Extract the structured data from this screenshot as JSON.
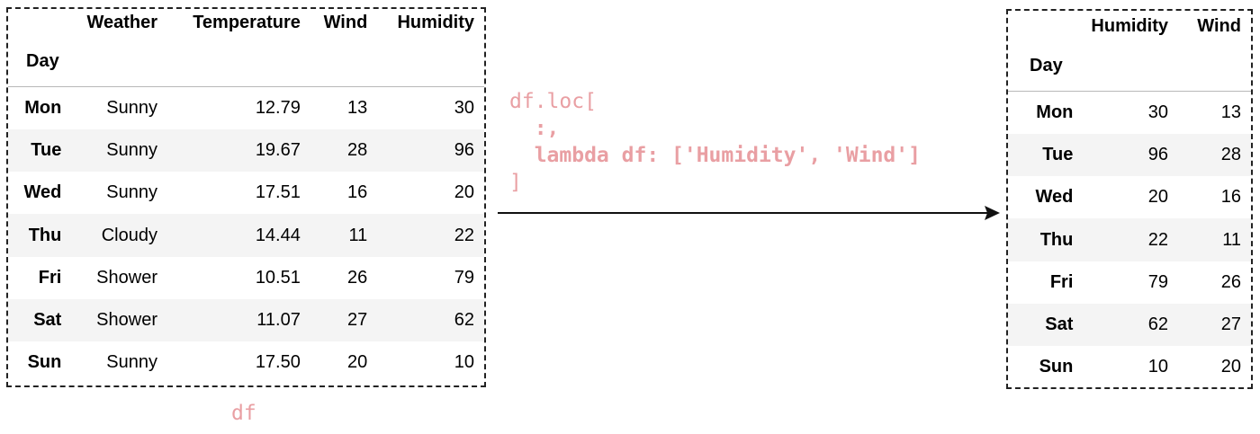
{
  "source_table": {
    "index_name": "Day",
    "columns": [
      "Weather",
      "Temperature",
      "Wind",
      "Humidity"
    ],
    "rows": [
      {
        "day": "Mon",
        "cells": [
          "Sunny",
          "12.79",
          "13",
          "30"
        ]
      },
      {
        "day": "Tue",
        "cells": [
          "Sunny",
          "19.67",
          "28",
          "96"
        ]
      },
      {
        "day": "Wed",
        "cells": [
          "Sunny",
          "17.51",
          "16",
          "20"
        ]
      },
      {
        "day": "Thu",
        "cells": [
          "Cloudy",
          "14.44",
          "11",
          "22"
        ]
      },
      {
        "day": "Fri",
        "cells": [
          "Shower",
          "10.51",
          "26",
          "79"
        ]
      },
      {
        "day": "Sat",
        "cells": [
          "Shower",
          "11.07",
          "27",
          "62"
        ]
      },
      {
        "day": "Sun",
        "cells": [
          "Sunny",
          "17.50",
          "20",
          "10"
        ]
      }
    ],
    "caption": "df"
  },
  "code": {
    "line1": "df.loc[",
    "line2": "  :,",
    "line3": "  lambda df: ['Humidity', 'Wind']",
    "line4": "]"
  },
  "result_table": {
    "index_name": "Day",
    "columns": [
      "Humidity",
      "Wind"
    ],
    "rows": [
      {
        "day": "Mon",
        "cells": [
          "30",
          "13"
        ]
      },
      {
        "day": "Tue",
        "cells": [
          "96",
          "28"
        ]
      },
      {
        "day": "Wed",
        "cells": [
          "20",
          "16"
        ]
      },
      {
        "day": "Thu",
        "cells": [
          "22",
          "11"
        ]
      },
      {
        "day": "Fri",
        "cells": [
          "79",
          "26"
        ]
      },
      {
        "day": "Sat",
        "cells": [
          "62",
          "27"
        ]
      },
      {
        "day": "Sun",
        "cells": [
          "10",
          "20"
        ]
      }
    ]
  },
  "colors": {
    "code_text": "#e99fa3",
    "frame_border": "#222222",
    "stripe": "#f4f4f4",
    "arrow": "#111111"
  }
}
